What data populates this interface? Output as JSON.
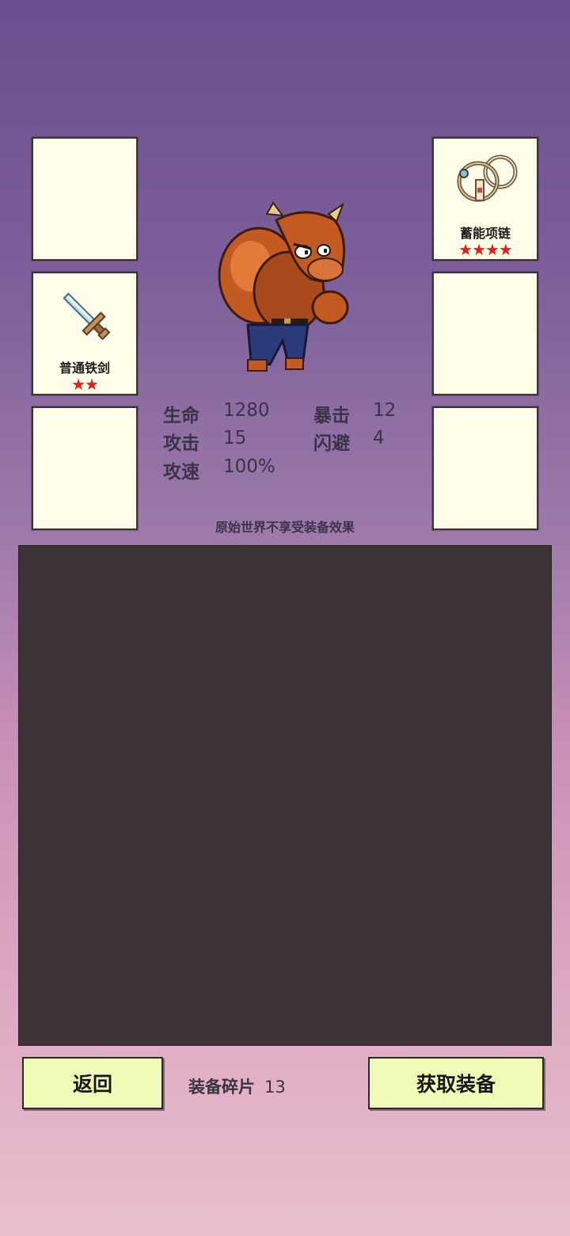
{
  "equipment": {
    "left_slots": [
      {
        "name": "",
        "stars": ""
      },
      {
        "name": "普通铁剑",
        "stars": "★★",
        "icon": "sword-icon"
      },
      {
        "name": "",
        "stars": ""
      }
    ],
    "right_slots": [
      {
        "name": "蓄能项链",
        "stars": "★★★★",
        "icon": "necklace-icon"
      },
      {
        "name": "",
        "stars": ""
      },
      {
        "name": "",
        "stars": ""
      }
    ]
  },
  "character": {
    "icon": "minotaur-character"
  },
  "stats": {
    "hp_label": "生命",
    "hp_value": "1280",
    "crit_label": "暴击",
    "crit_value": "12",
    "atk_label": "攻击",
    "atk_value": "15",
    "dodge_label": "闪避",
    "dodge_value": "4",
    "speed_label": "攻速",
    "speed_value": "100%"
  },
  "note": "原始世界不享受装备效果",
  "footer": {
    "back_label": "返回",
    "shards_label": "装备碎片",
    "shards_count": "13",
    "get_label": "获取装备"
  },
  "colors": {
    "slot_bg": "#fdfde9",
    "button_bg": "#f0fbb8",
    "star": "#ee1a1a",
    "panel": "#3e3337"
  }
}
